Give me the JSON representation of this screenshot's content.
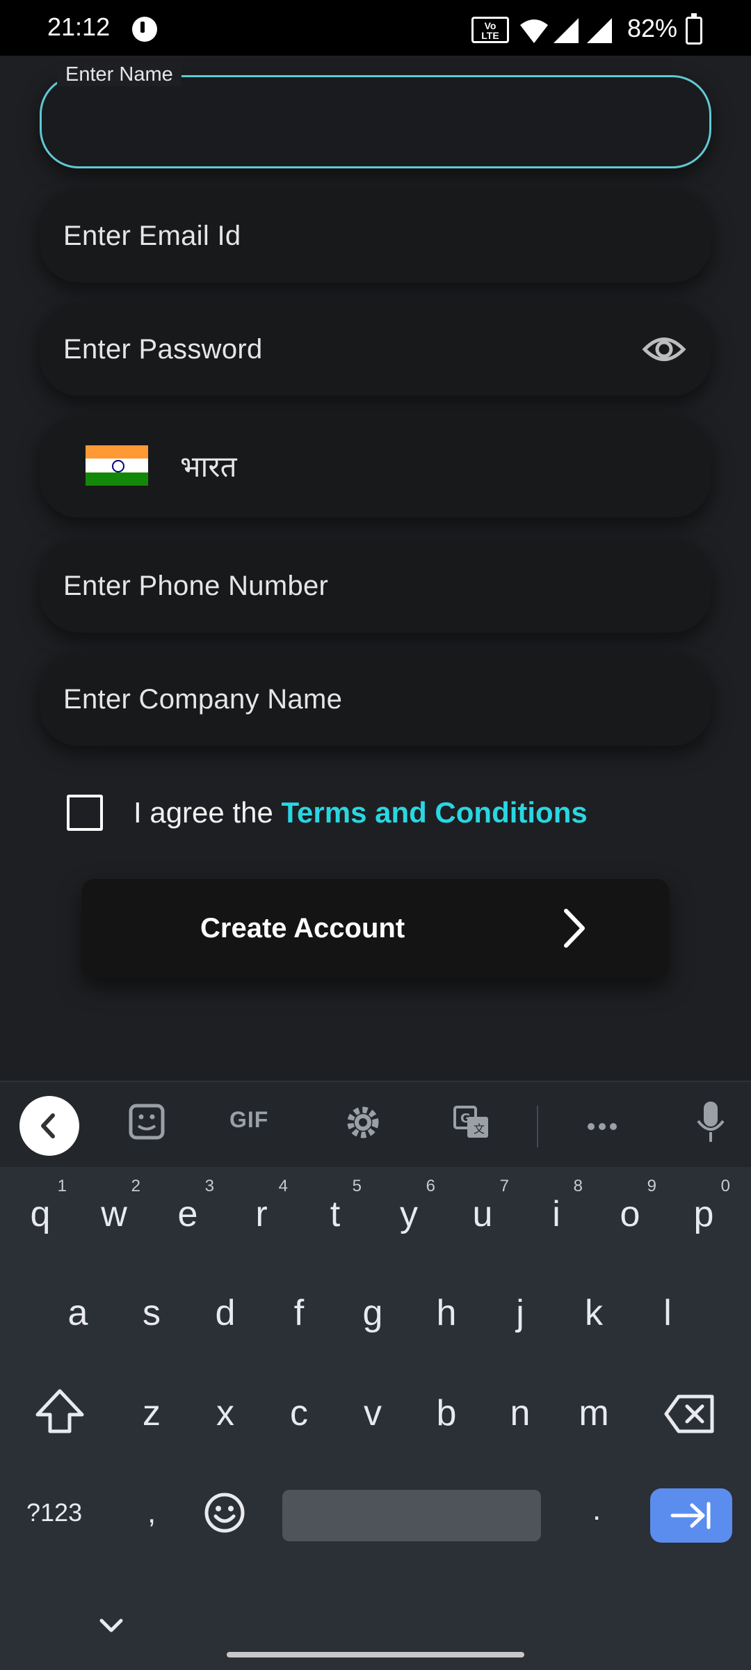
{
  "status_bar": {
    "time": "21:12",
    "network_badge": "VoLTE 1",
    "battery_percent": "82%"
  },
  "form": {
    "name_label": "Enter Name",
    "name_value": "",
    "email_placeholder": "Enter Email Id",
    "password_placeholder": "Enter Password",
    "country_name": "भारत",
    "phone_placeholder": "Enter Phone Number",
    "company_placeholder": "Enter Company Name",
    "agree_prefix": "I agree the ",
    "terms_link": "Terms and Conditions",
    "agree_checked": false,
    "create_button": "Create Account"
  },
  "keyboard": {
    "toolbar": {
      "gif_label": "GIF",
      "icons": [
        "back-icon",
        "sticker-icon",
        "gif-icon",
        "settings-icon",
        "translate-icon",
        "more-icon",
        "microphone-icon"
      ]
    },
    "row1": [
      {
        "k": "q",
        "n": "1"
      },
      {
        "k": "w",
        "n": "2"
      },
      {
        "k": "e",
        "n": "3"
      },
      {
        "k": "r",
        "n": "4"
      },
      {
        "k": "t",
        "n": "5"
      },
      {
        "k": "y",
        "n": "6"
      },
      {
        "k": "u",
        "n": "7"
      },
      {
        "k": "i",
        "n": "8"
      },
      {
        "k": "o",
        "n": "9"
      },
      {
        "k": "p",
        "n": "0"
      }
    ],
    "row2": [
      "a",
      "s",
      "d",
      "f",
      "g",
      "h",
      "j",
      "k",
      "l"
    ],
    "row3": [
      "z",
      "x",
      "c",
      "v",
      "b",
      "n",
      "m"
    ],
    "symbols_label": "?123",
    "comma": ",",
    "period": "."
  },
  "colors": {
    "accent_cyan": "#29d7e3",
    "focus_border": "#5fc9d2",
    "enter_key": "#5b8def",
    "background": "#1e1f22"
  }
}
